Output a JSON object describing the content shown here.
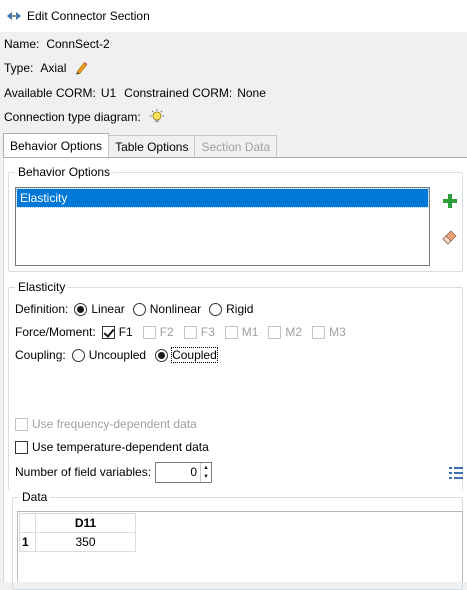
{
  "window": {
    "title": "Edit Connector Section",
    "icon": "connector-arrows-icon"
  },
  "info": {
    "name_label": "Name:",
    "name_value": "ConnSect-2",
    "type_label": "Type:",
    "type_value": "Axial",
    "type_edit_icon": "pencil-icon",
    "available_corm_label": "Available CORM:",
    "available_corm_value": "U1",
    "constrained_corm_label": "Constrained CORM:",
    "constrained_corm_value": "None",
    "diagram_label": "Connection type diagram:",
    "diagram_icon": "lightbulb-icon"
  },
  "tabs": [
    {
      "label": "Behavior Options",
      "active": true,
      "enabled": true
    },
    {
      "label": "Table Options",
      "active": false,
      "enabled": true
    },
    {
      "label": "Section Data",
      "active": false,
      "enabled": false
    }
  ],
  "behavior_options": {
    "group_title": "Behavior Options",
    "items": [
      "Elasticity"
    ],
    "selected": "Elasticity",
    "add_icon": "plus-icon",
    "delete_icon": "eraser-icon",
    "colors": {
      "add": "#2e9e3a",
      "selection": "#0078d7"
    }
  },
  "elasticity": {
    "group_title": "Elasticity",
    "definition_label": "Definition:",
    "definition_options": [
      "Linear",
      "Nonlinear",
      "Rigid"
    ],
    "definition_selected": "Linear",
    "force_moment_label": "Force/Moment:",
    "components": [
      {
        "label": "F1",
        "checked": true,
        "enabled": true
      },
      {
        "label": "F2",
        "checked": false,
        "enabled": false
      },
      {
        "label": "F3",
        "checked": false,
        "enabled": false
      },
      {
        "label": "M1",
        "checked": false,
        "enabled": false
      },
      {
        "label": "M2",
        "checked": false,
        "enabled": false
      },
      {
        "label": "M3",
        "checked": false,
        "enabled": false
      }
    ],
    "coupling_label": "Coupling:",
    "coupling_options": [
      "Uncoupled",
      "Coupled"
    ],
    "coupling_selected": "Coupled",
    "freq_dependent_label": "Use frequency-dependent data",
    "freq_dependent_checked": false,
    "freq_dependent_enabled": false,
    "temp_dependent_label": "Use temperature-dependent data",
    "temp_dependent_checked": false,
    "field_vars_label": "Number of field variables:",
    "field_vars_value": "0",
    "table_tools_icon": "table-options-icon"
  },
  "data": {
    "group_title": "Data",
    "columns": [
      "D11"
    ],
    "rows": [
      {
        "index": "1",
        "cells": [
          "350"
        ]
      }
    ]
  }
}
